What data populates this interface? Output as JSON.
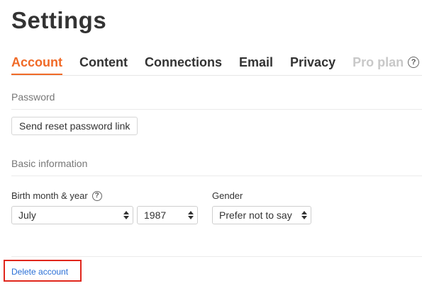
{
  "page": {
    "title": "Settings"
  },
  "tabs": [
    {
      "label": "Account",
      "state": "active"
    },
    {
      "label": "Content",
      "state": "normal"
    },
    {
      "label": "Connections",
      "state": "normal"
    },
    {
      "label": "Email",
      "state": "normal"
    },
    {
      "label": "Privacy",
      "state": "normal"
    },
    {
      "label": "Pro plan",
      "state": "disabled"
    }
  ],
  "help_glyph": "?",
  "password": {
    "heading": "Password",
    "reset_button_label": "Send reset password link"
  },
  "basic_info": {
    "heading": "Basic information",
    "birth_label": "Birth month & year",
    "birth_month": "July",
    "birth_year": "1987",
    "gender_label": "Gender",
    "gender_value": "Prefer not to say"
  },
  "footer": {
    "delete_link": "Delete account"
  },
  "colors": {
    "accent": "#f06a27",
    "link": "#2a6fd6",
    "highlight": "#e0261c"
  }
}
